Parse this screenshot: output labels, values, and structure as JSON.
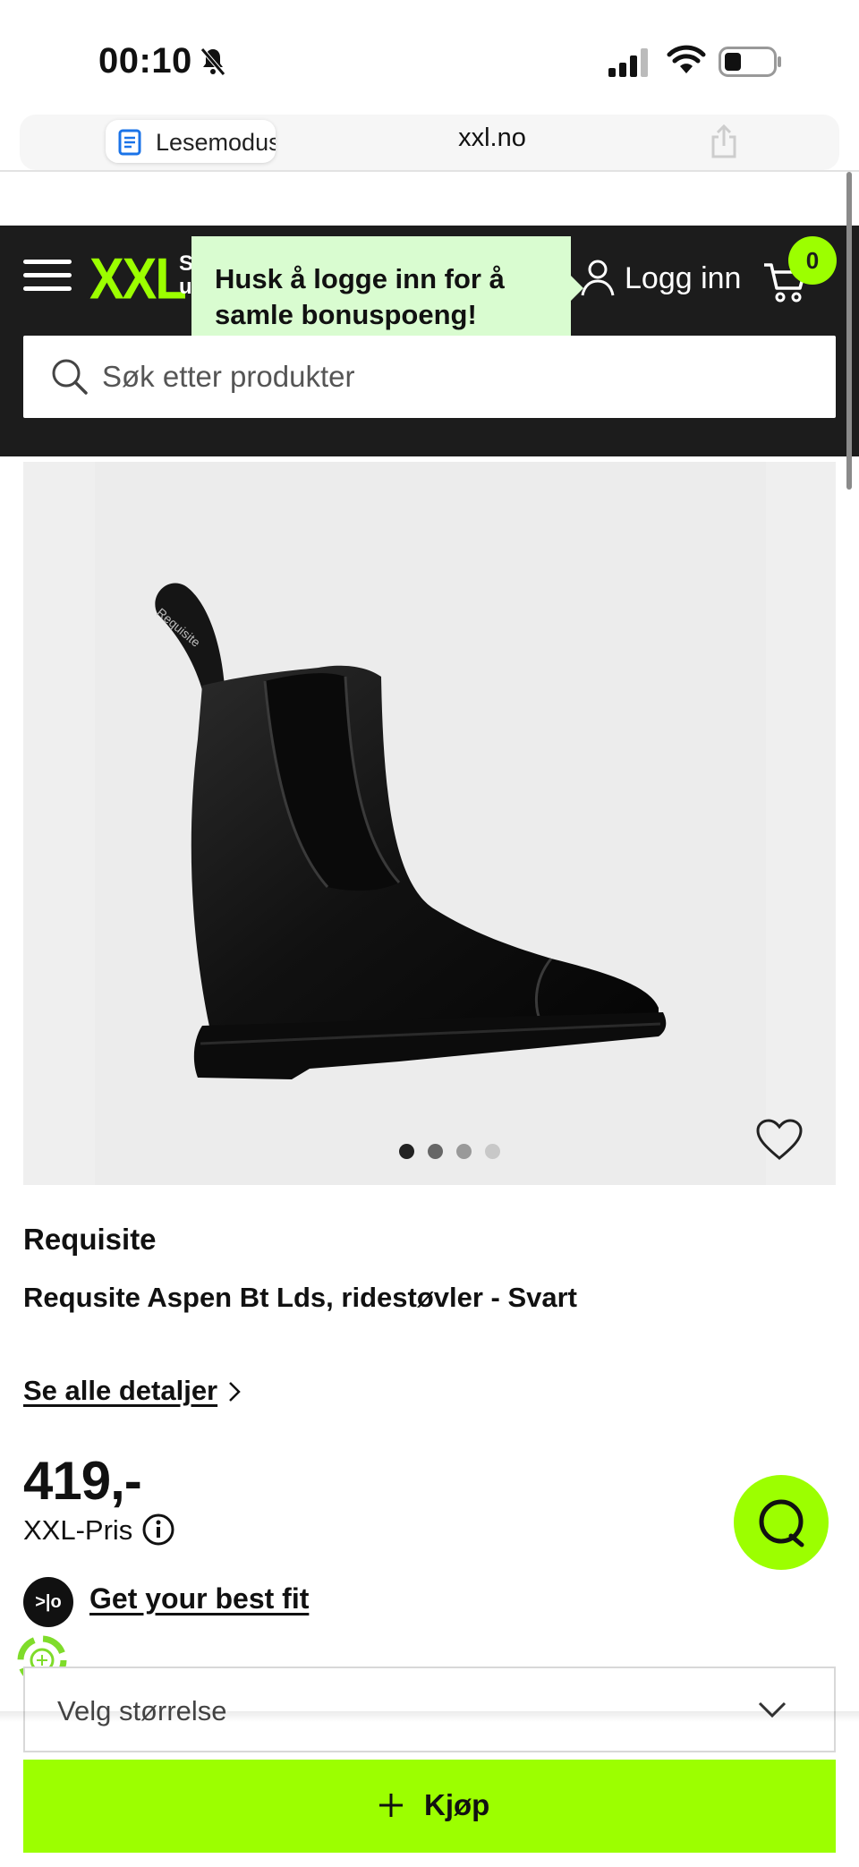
{
  "status_bar": {
    "time": "00:10"
  },
  "browser": {
    "reader_label": "Lesemodus",
    "url": "xxl.no"
  },
  "header": {
    "logo_text": "XXL",
    "logo_tag_line1": "S",
    "logo_tag_line2": "u",
    "login_label": "Logg inn",
    "cart_count": "0",
    "tooltip_text": "Husk å logge inn for å samle bonuspoeng!",
    "search_placeholder": "Søk etter produkter"
  },
  "gallery": {
    "image_count": 4,
    "active_index": 0
  },
  "product": {
    "brand": "Requisite",
    "name": "Requsite Aspen Bt Lds, ridestøvler - Svart",
    "details_link": "Se alle detaljer",
    "price": "419,-",
    "price_label": "XXL-Pris",
    "fit_badge": ">|o",
    "fit_link": "Get your best fit",
    "size_placeholder": "Velg størrelse",
    "buy_label": "Kjøp"
  },
  "colors": {
    "accent": "#9cff00",
    "header_bg": "#1c1c1c",
    "tooltip_bg": "#d9fcd0"
  }
}
